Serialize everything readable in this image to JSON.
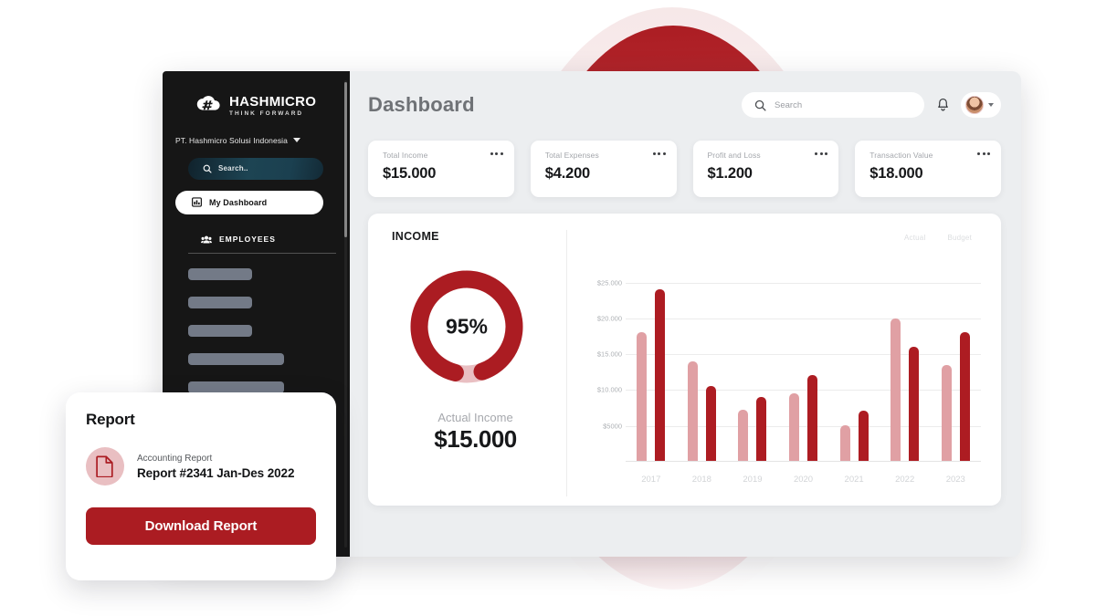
{
  "sidebar": {
    "logo": {
      "name": "HASHMICRO",
      "tagline": "THINK FORWARD",
      "icon": "cloud-hash-icon"
    },
    "company": "PT. Hashmicro Solusi Indonesia",
    "search_label": "Search..",
    "nav_active": "My Dashboard",
    "section_label": "EMPLOYEES",
    "placeholder_widths": [
      70,
      70,
      70,
      105,
      105
    ]
  },
  "header": {
    "title": "Dashboard",
    "search_placeholder": "Search",
    "bell": "notification-bell-icon",
    "avatar": "user-avatar"
  },
  "kpis": [
    {
      "label": "Total Income",
      "value": "$15.000"
    },
    {
      "label": "Total Expenses",
      "value": "$4.200"
    },
    {
      "label": "Profit and Loss",
      "value": "$1.200"
    },
    {
      "label": "Transaction Value",
      "value": "$18.000"
    }
  ],
  "income": {
    "heading": "INCOME",
    "percent": "95%",
    "percent_value": 95,
    "actual_label": "Actual Income",
    "actual_value": "$15.000"
  },
  "report": {
    "title": "Report",
    "subtitle": "Accounting Report",
    "name": "Report #2341 Jan-Des 2022",
    "button": "Download Report",
    "icon": "document-file-icon"
  },
  "colors": {
    "brand_red": "#ab1c22",
    "light_red": "#e0a0a4",
    "sidebar_bg": "#161616",
    "panel_bg": "#eceef0"
  },
  "chart_data": {
    "type": "bar",
    "title": "INCOME",
    "xlabel": "",
    "ylabel": "",
    "grid": true,
    "legend_position": "top-right",
    "categories": [
      "2017",
      "2018",
      "2019",
      "2020",
      "2021",
      "2022",
      "2023"
    ],
    "ytick_labels": [
      "$5000",
      "$10.000",
      "$15.000",
      "$20.000",
      "$25.000"
    ],
    "ytick_values": [
      5000,
      10000,
      15000,
      20000,
      25000
    ],
    "ylim": [
      0,
      27000
    ],
    "series": [
      {
        "name": "Actual",
        "color": "#e0a0a4",
        "values": [
          18000,
          14000,
          7200,
          9500,
          5000,
          20000,
          13500
        ]
      },
      {
        "name": "Budget",
        "color": "#ad1c22",
        "values": [
          24000,
          10500,
          9000,
          12000,
          7000,
          16000,
          18000
        ]
      }
    ]
  }
}
